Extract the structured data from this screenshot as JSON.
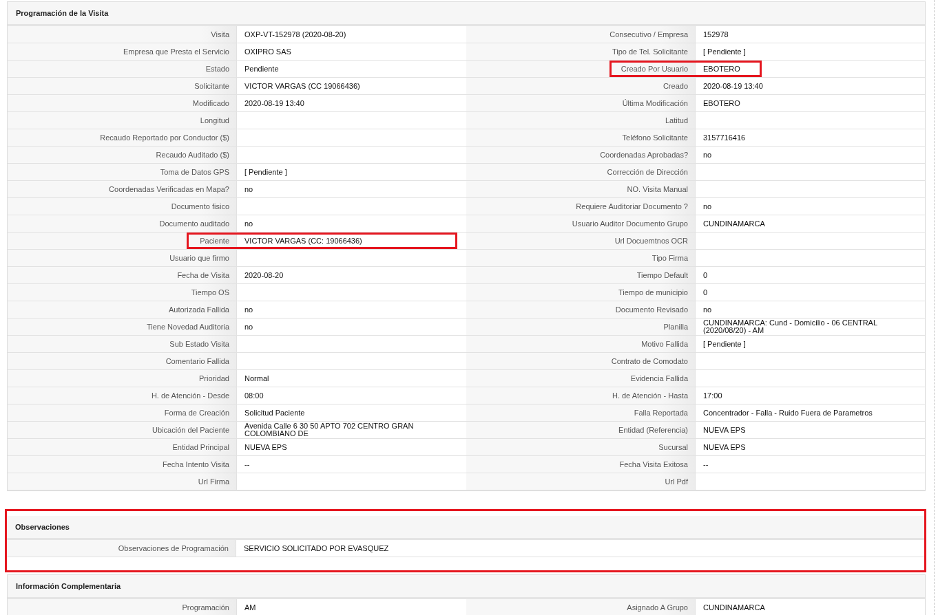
{
  "sections": [
    {
      "title": "Programación de la Visita",
      "highlighted": false,
      "rows": [
        {
          "fields": [
            {
              "label": "Visita",
              "value": "OXP-VT-152978 (2020-08-20)",
              "highlighted": false
            },
            {
              "label": "Consecutivo / Empresa",
              "value": "152978",
              "highlighted": false
            }
          ]
        },
        {
          "fields": [
            {
              "label": "Empresa que Presta el Servicio",
              "value": "OXIPRO SAS",
              "highlighted": false
            },
            {
              "label": "Tipo de Tel. Solicitante",
              "value": "[ Pendiente ]",
              "highlighted": false
            }
          ]
        },
        {
          "fields": [
            {
              "label": "Estado",
              "value": "Pendiente",
              "highlighted": false
            },
            {
              "label": "Creado Por Usuario",
              "value": "EBOTERO",
              "highlighted": true
            }
          ]
        },
        {
          "fields": [
            {
              "label": "Solicitante",
              "value": "VICTOR VARGAS (CC 19066436)",
              "highlighted": false
            },
            {
              "label": "Creado",
              "value": "2020-08-19 13:40",
              "highlighted": false
            }
          ]
        },
        {
          "fields": [
            {
              "label": "Modificado",
              "value": "2020-08-19 13:40",
              "highlighted": false
            },
            {
              "label": "Última Modificación",
              "value": "EBOTERO",
              "highlighted": false
            }
          ]
        },
        {
          "fields": [
            {
              "label": "Longitud",
              "highlighted": false
            },
            {
              "label": "Latitud",
              "highlighted": false
            }
          ]
        },
        {
          "fields": [
            {
              "label": "Recaudo Reportado por Conductor ($)",
              "highlighted": false
            },
            {
              "label": "Teléfono Solicitante",
              "value": "3157716416",
              "highlighted": false
            }
          ]
        },
        {
          "fields": [
            {
              "label": "Recaudo Auditado ($)",
              "highlighted": false
            },
            {
              "label": "Coordenadas Aprobadas?",
              "value": "no",
              "highlighted": false
            }
          ]
        },
        {
          "fields": [
            {
              "label": "Toma de Datos GPS",
              "value": "[ Pendiente ]",
              "highlighted": false
            },
            {
              "label": "Corrección de Dirección",
              "highlighted": false
            }
          ]
        },
        {
          "fields": [
            {
              "label": "Coordenadas Verificadas en Mapa?",
              "value": "no",
              "highlighted": false
            },
            {
              "label": "NO. Visita Manual",
              "highlighted": false
            }
          ]
        },
        {
          "fields": [
            {
              "label": "Documento fisico",
              "highlighted": false
            },
            {
              "label": "Requiere Auditoriar Documento ?",
              "value": "no",
              "highlighted": false
            }
          ]
        },
        {
          "fields": [
            {
              "label": "Documento auditado",
              "value": "no",
              "highlighted": false
            },
            {
              "label": "Usuario Auditor Documento Grupo",
              "value": "CUNDINAMARCA",
              "highlighted": false
            }
          ]
        },
        {
          "fields": [
            {
              "label": "Paciente",
              "value": "VICTOR VARGAS (CC: 19066436)",
              "highlighted": true
            },
            {
              "label": "Url Docuemtnos OCR",
              "highlighted": false
            }
          ]
        },
        {
          "fields": [
            {
              "label": "Usuario que firmo",
              "highlighted": false
            },
            {
              "label": "Tipo Firma",
              "highlighted": false
            }
          ]
        },
        {
          "fields": [
            {
              "label": "Fecha de Visita",
              "value": "2020-08-20",
              "highlighted": false
            },
            {
              "label": "Tiempo Default",
              "value": "0",
              "highlighted": false
            }
          ]
        },
        {
          "fields": [
            {
              "label": "Tiempo OS",
              "highlighted": false
            },
            {
              "label": "Tiempo de municipio",
              "value": "0",
              "highlighted": false
            }
          ]
        },
        {
          "fields": [
            {
              "label": "Autorizada Fallida",
              "value": "no",
              "highlighted": false
            },
            {
              "label": "Documento Revisado",
              "value": "no",
              "highlighted": false
            }
          ]
        },
        {
          "fields": [
            {
              "label": "Tiene Novedad Auditoria",
              "value": "no",
              "highlighted": false
            },
            {
              "label": "Planilla",
              "value": "CUNDINAMARCA: Cund - Domicilio - 06 CENTRAL (2020/08/20) - AM",
              "highlighted": false
            }
          ]
        },
        {
          "fields": [
            {
              "label": "Sub Estado Visita",
              "highlighted": false
            },
            {
              "label": "Motivo Fallida",
              "value": "[ Pendiente ]",
              "highlighted": false
            }
          ]
        },
        {
          "fields": [
            {
              "label": "Comentario Fallida",
              "highlighted": false
            },
            {
              "label": "Contrato de Comodato",
              "highlighted": false
            }
          ]
        },
        {
          "fields": [
            {
              "label": "Prioridad",
              "value": "Normal",
              "highlighted": false
            },
            {
              "label": "Evidencia Fallida",
              "highlighted": false
            }
          ]
        },
        {
          "fields": [
            {
              "label": "H. de Atención - Desde",
              "value": "08:00",
              "highlighted": false
            },
            {
              "label": "H. de Atención - Hasta",
              "value": "17:00",
              "highlighted": false
            }
          ]
        },
        {
          "fields": [
            {
              "label": "Forma de Creación",
              "value": "Solicitud Paciente",
              "highlighted": false
            },
            {
              "label": "Falla Reportada",
              "value": "Concentrador - Falla - Ruido Fuera de Parametros",
              "highlighted": false
            }
          ]
        },
        {
          "fields": [
            {
              "label": "Ubicación del Paciente",
              "value": "Avenida Calle 6 30 50 APTO 702 CENTRO GRAN COLOMBIANO DE",
              "highlighted": false
            },
            {
              "label": "Entidad (Referencia)",
              "value": "NUEVA EPS",
              "highlighted": false
            }
          ]
        },
        {
          "fields": [
            {
              "label": "Entidad Principal",
              "value": "NUEVA EPS",
              "highlighted": false
            },
            {
              "label": "Sucursal",
              "value": "NUEVA EPS",
              "highlighted": false
            }
          ]
        },
        {
          "fields": [
            {
              "label": "Fecha Intento Visita",
              "value": "--",
              "highlighted": false
            },
            {
              "label": "Fecha Visita Exitosa",
              "value": "--",
              "highlighted": false
            }
          ]
        },
        {
          "fields": [
            {
              "label": "Url Firma",
              "highlighted": false
            },
            {
              "label": "Url Pdf",
              "highlighted": false
            }
          ]
        }
      ]
    },
    {
      "title": "Observaciones",
      "highlighted": true,
      "rows": [
        {
          "fields": [
            {
              "label": "Observaciones de Programación",
              "value": "SERVICIO SOLICITADO POR EVASQUEZ",
              "highlighted": false
            }
          ]
        }
      ]
    },
    {
      "title": "Información Complementaria",
      "highlighted": false,
      "rows": [
        {
          "fields": [
            {
              "label": "Programación",
              "value": "AM",
              "highlighted": false
            },
            {
              "label": "Asignado A Grupo",
              "value": "CUNDINAMARCA",
              "highlighted": false
            }
          ]
        }
      ]
    }
  ]
}
